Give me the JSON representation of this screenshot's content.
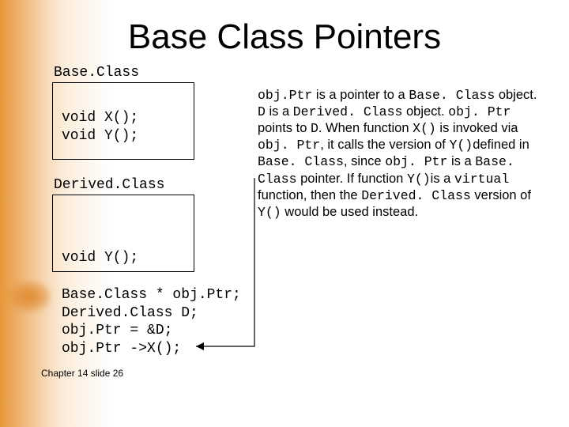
{
  "title": "Base Class Pointers",
  "labels": {
    "baseclass": "Base.Class",
    "derivedclass": "Derived.Class"
  },
  "box1": {
    "line1": "void X();",
    "line2": "void Y();"
  },
  "box2": {
    "line1": "void Y();"
  },
  "code": {
    "l1": "Base.Class * obj.Ptr;",
    "l2": "Derived.Class D;",
    "l3": "obj.Ptr = &D;",
    "l4": "obj.Ptr ->X();"
  },
  "para": {
    "t1": "obj.Ptr",
    "t2": " is a pointer to a ",
    "t3": "Base. Class",
    "t4": " object.  ",
    "t5": "D",
    "t6": " is a ",
    "t7": "Derived. Class",
    "t8": " object. ",
    "t9": "obj. Ptr",
    "t10": " points to ",
    "t11": "D",
    "t12": ".  When function ",
    "t13": "X()",
    "t14": " is invoked via ",
    "t15": "obj. Ptr",
    "t16": ", it calls the version of ",
    "t17": "Y()",
    "t18": "defined in ",
    "t19": "Base. Class",
    "t20": ", since ",
    "t21": "obj. Ptr",
    "t22": " is a ",
    "t23": "Base. Class",
    "t24": " pointer. If function ",
    "t25": "Y()",
    "t26": "is a ",
    "t27": "virtual",
    "t28": " function,  then the ",
    "t29": "Derived. Class",
    "t30": " version of ",
    "t31": "Y()",
    "t32": " would be used instead."
  },
  "footer": "Chapter 14 slide 26"
}
